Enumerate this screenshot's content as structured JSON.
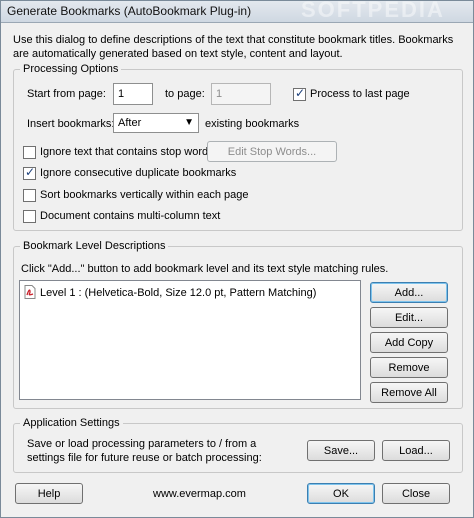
{
  "window": {
    "title": "Generate Bookmarks (AutoBookmark Plug-in)",
    "watermark": "SOFTPEDIA"
  },
  "intro_text": "Use this dialog to define descriptions of the text that constitute bookmark titles. Bookmarks are automatically generated based on text style, content and layout.",
  "processing": {
    "group_label": "Processing Options",
    "start_label": "Start from page:",
    "start_value": "1",
    "to_label": "to page:",
    "to_value": "1",
    "process_last_label": "Process to last page",
    "process_last_checked": true,
    "insert_label": "Insert bookmarks:",
    "insert_value": "After",
    "insert_suffix": "existing bookmarks",
    "ignore_stop_label": "Ignore text that contains stop words:",
    "ignore_stop_checked": false,
    "edit_stop_words_label": "Edit Stop Words...",
    "ignore_duplicate_label": "Ignore consecutive duplicate bookmarks",
    "ignore_duplicate_checked": true,
    "sort_label": "Sort bookmarks vertically within each page",
    "sort_checked": false,
    "multicolumn_label": "Document contains multi-column text",
    "multicolumn_checked": false
  },
  "levels": {
    "group_label": "Bookmark Level Descriptions",
    "hint": "Click \"Add...\" button to add bookmark level and its text style matching rules.",
    "items": [
      {
        "label": "Level 1 : (Helvetica-Bold, Size 12.0 pt, Pattern Matching)"
      }
    ],
    "add_label": "Add...",
    "edit_label": "Edit...",
    "add_copy_label": "Add Copy",
    "remove_label": "Remove",
    "remove_all_label": "Remove All"
  },
  "app_settings": {
    "group_label": "Application Settings",
    "description": "Save or load processing parameters to / from a settings file for future reuse or batch processing:",
    "save_label": "Save...",
    "load_label": "Load..."
  },
  "footer": {
    "help_label": "Help",
    "website": "www.evermap.com",
    "ok_label": "OK",
    "close_label": "Close"
  },
  "colors": {
    "dialog_bg": "#f0f0f0",
    "default_button_border": "#3c7fb1",
    "pdf_icon_red": "#c8202a"
  }
}
